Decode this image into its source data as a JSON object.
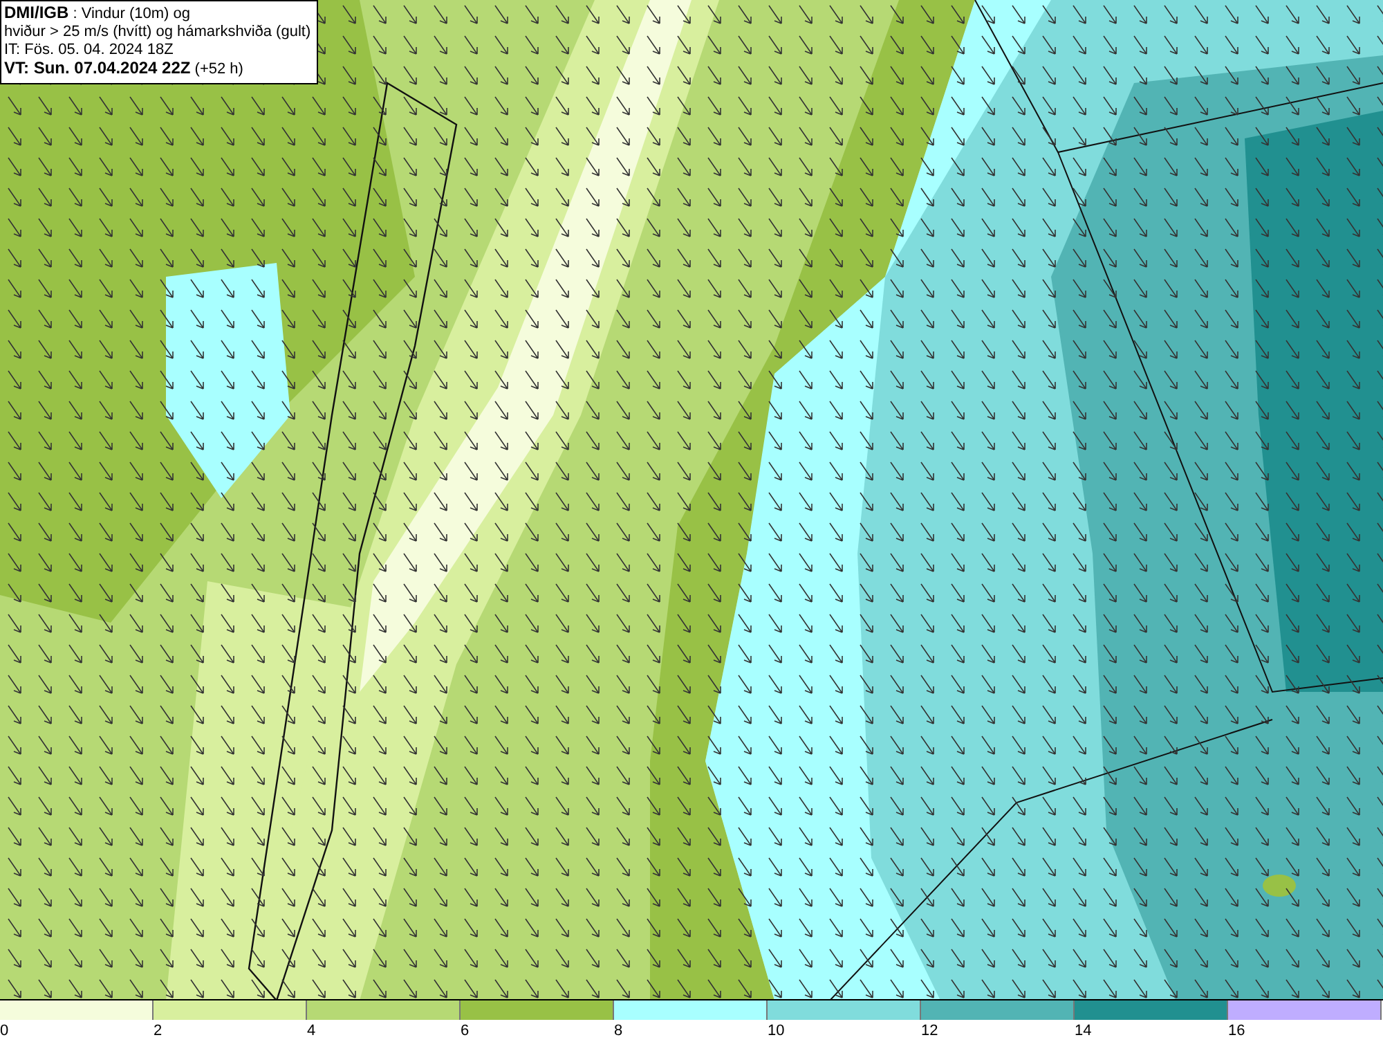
{
  "info": {
    "lines": [
      "**DMI/IGB** : Vindur (10m) og",
      "hviður > 25 m/s (hvítt) og hámarkshviða (gult)",
      "IT: Fös. 05. 04. 2024 18Z",
      "**VT: Sun. 07.04.2024 22Z** (+52 h)"
    ]
  },
  "legend": [
    {
      "label": "0",
      "color": "#f5fcdc"
    },
    {
      "label": "2",
      "color": "#d8ef9e"
    },
    {
      "label": "4",
      "color": "#b6d974"
    },
    {
      "label": "6",
      "color": "#98c146"
    },
    {
      "label": "8",
      "color": "#a8ffff"
    },
    {
      "label": "10",
      "color": "#80dcdc"
    },
    {
      "label": "12",
      "color": "#52b4b4"
    },
    {
      "label": "14",
      "color": "#219090"
    },
    {
      "label": "16",
      "color": "#bfadff"
    }
  ]
}
